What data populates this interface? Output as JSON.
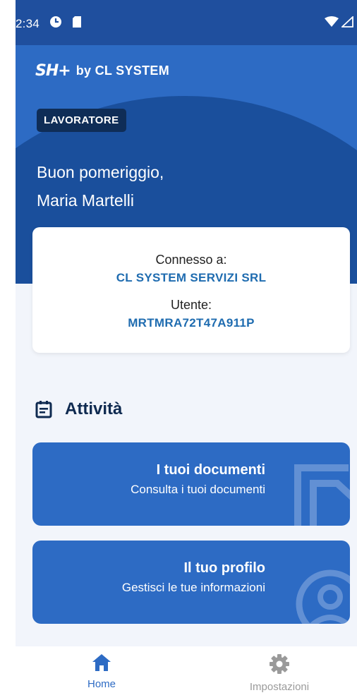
{
  "status_bar": {
    "time": "2:34"
  },
  "header": {
    "logo_mark": "SH+",
    "logo_text": "by CL SYSTEM",
    "role_badge": "LAVORATORE",
    "greeting_line1": "Buon pomeriggio,",
    "greeting_line2": "Maria Martelli"
  },
  "info_card": {
    "connected_label": "Connesso a:",
    "connected_value": "CL SYSTEM SERVIZI SRL",
    "user_label": "Utente:",
    "user_value": "MRTMRA72T47A911P"
  },
  "activities": {
    "title": "Attività",
    "items": [
      {
        "title": "I tuoi documenti",
        "subtitle": "Consulta i tuoi documenti",
        "icon": "documents-icon"
      },
      {
        "title": "Il tuo profilo",
        "subtitle": "Gestisci le tue informazioni",
        "icon": "profile-icon"
      }
    ]
  },
  "bottom_nav": {
    "items": [
      {
        "label": "Home",
        "icon": "home-icon",
        "active": true
      },
      {
        "label": "Impostazioni",
        "icon": "gear-icon",
        "active": false
      }
    ]
  },
  "colors": {
    "primary": "#2d6bc4",
    "dark_arc": "#1a4f9c",
    "badge": "#0f2d57",
    "accent_text": "#1f6cb0",
    "nav_active": "#2d6bc4",
    "nav_inactive": "#9a9a9a"
  }
}
